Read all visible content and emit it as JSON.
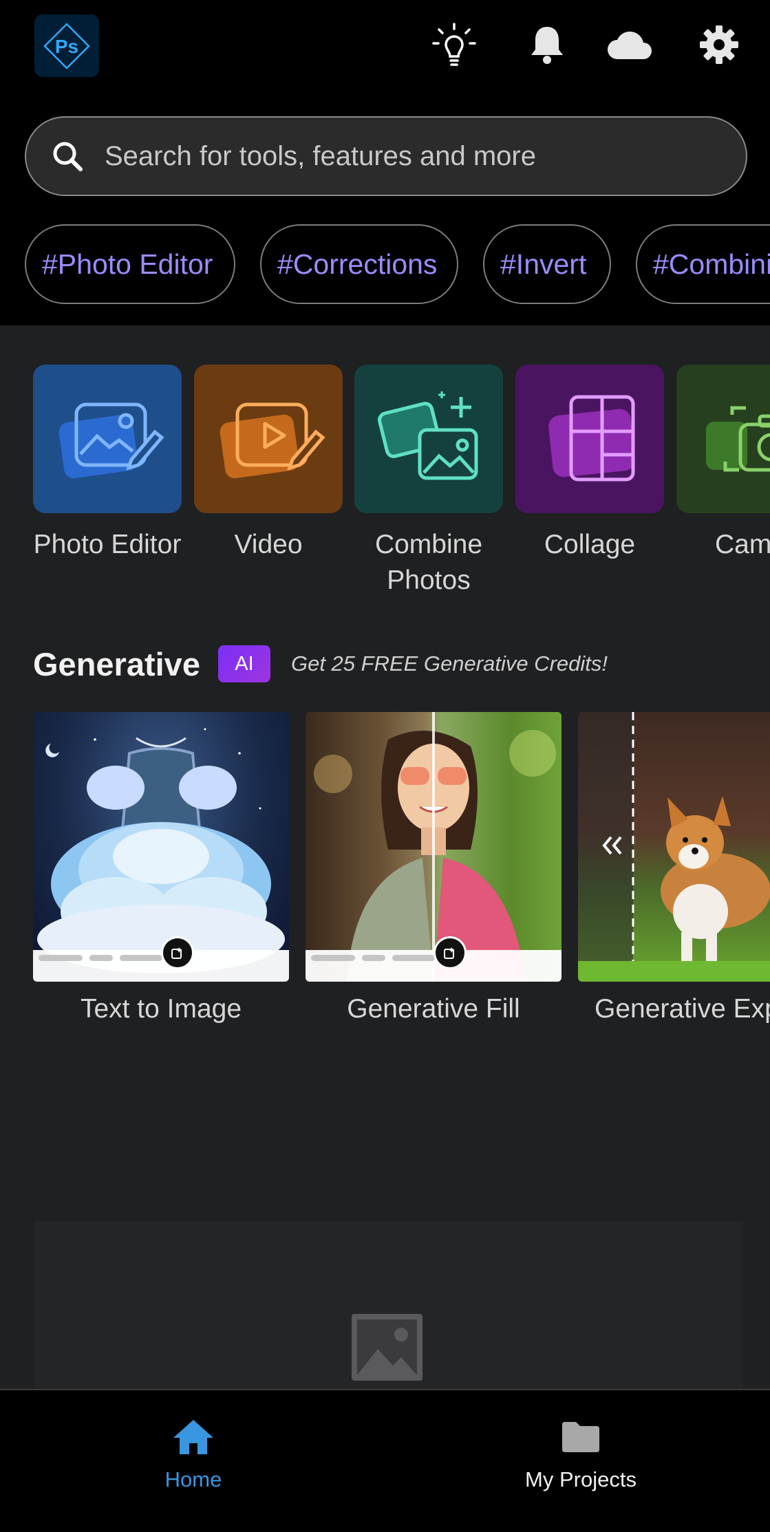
{
  "header": {
    "logo_text": "Ps",
    "icons": [
      "lightbulb-icon",
      "bell-icon",
      "cloud-icon",
      "gear-icon"
    ]
  },
  "search": {
    "placeholder": "Search for tools, features and more"
  },
  "chips": [
    "#Photo Editor",
    "#Corrections",
    "#Invert",
    "#Combini"
  ],
  "tools": [
    {
      "label": "Photo Editor",
      "color": "#1f4f8a",
      "icon": "photo-edit-icon"
    },
    {
      "label": "Video",
      "color": "#6b3c12",
      "icon": "video-edit-icon"
    },
    {
      "label": "Combine Photos",
      "color": "#14413d",
      "icon": "combine-photos-icon"
    },
    {
      "label": "Collage",
      "color": "#4a1560",
      "icon": "collage-icon"
    },
    {
      "label": "Came",
      "color": "#26401f",
      "icon": "camera-icon"
    }
  ],
  "generative": {
    "title": "Generative",
    "badge": "AI",
    "promo": "Get 25 FREE Generative Credits!",
    "cards": [
      {
        "label": "Text to Image"
      },
      {
        "label": "Generative Fill"
      },
      {
        "label": "Generative Exp"
      }
    ]
  },
  "nav": {
    "home": "Home",
    "projects": "My Projects"
  },
  "colors": {
    "accent_blue": "#3a96e0",
    "chip_text": "#9b8cff",
    "ai_badge": "#8a2be2"
  }
}
